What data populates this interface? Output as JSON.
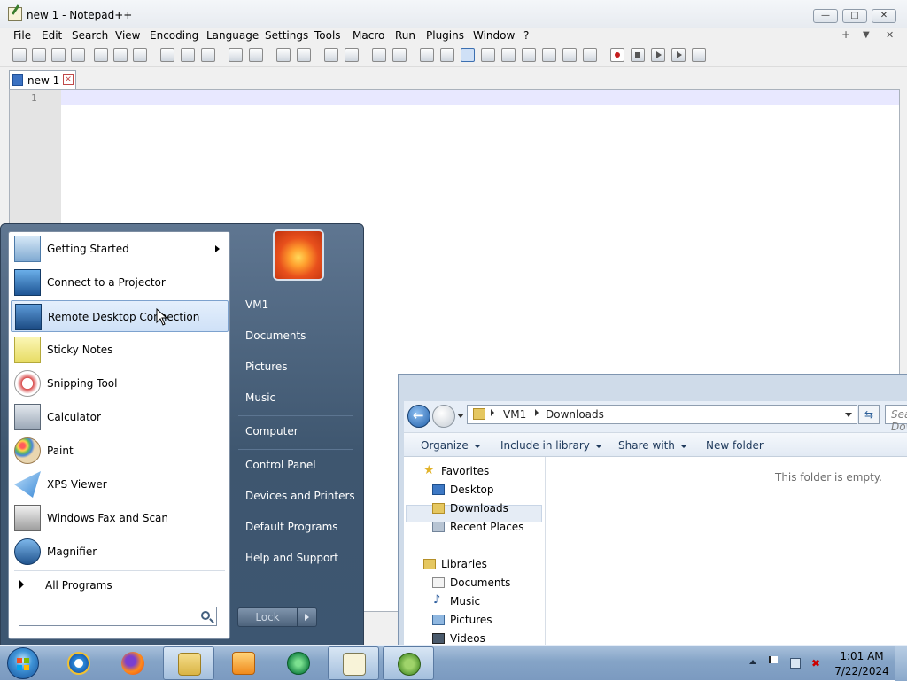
{
  "notepad": {
    "title": "new 1 - Notepad++",
    "menu": [
      "File",
      "Edit",
      "Search",
      "View",
      "Encoding",
      "Language",
      "Settings",
      "Tools",
      "Macro",
      "Run",
      "Plugins",
      "Window",
      "?"
    ],
    "menu_right": [
      "+",
      "▼",
      "✕"
    ],
    "tab_label": "new 1",
    "line_number": "1",
    "window_buttons": {
      "minimize": "—",
      "maximize": "□",
      "close": "✕"
    }
  },
  "explorer": {
    "breadcrumb": [
      "VM1",
      "Downloads"
    ],
    "search_placeholder": "Search Downloads",
    "commands": [
      "Organize",
      "Include in library",
      "Share with",
      "New folder"
    ],
    "nav": {
      "favorites_header": "Favorites",
      "favorites": [
        "Desktop",
        "Downloads",
        "Recent Places"
      ],
      "libraries_header": "Libraries",
      "libraries": [
        "Documents",
        "Music",
        "Pictures",
        "Videos"
      ],
      "selected": "Downloads"
    },
    "empty_message": "This folder is empty."
  },
  "start_menu": {
    "programs": [
      {
        "label": "Getting Started",
        "icon": "getting-started-icon",
        "has_submenu": true
      },
      {
        "label": "Connect to a Projector",
        "icon": "projector-icon"
      },
      {
        "label": "Remote Desktop Connection",
        "icon": "remote-desktop-icon",
        "highlighted": true
      },
      {
        "label": "Sticky Notes",
        "icon": "sticky-notes-icon"
      },
      {
        "label": "Snipping Tool",
        "icon": "scissors-icon"
      },
      {
        "label": "Calculator",
        "icon": "calculator-icon"
      },
      {
        "label": "Paint",
        "icon": "paint-palette-icon"
      },
      {
        "label": "XPS Viewer",
        "icon": "xps-viewer-icon"
      },
      {
        "label": "Windows Fax and Scan",
        "icon": "fax-icon"
      },
      {
        "label": "Magnifier",
        "icon": "magnifier-icon"
      }
    ],
    "all_programs": "All Programs",
    "search_placeholder": "",
    "right_items": [
      "VM1",
      "Documents",
      "Pictures",
      "Music",
      "Computer",
      "Control Panel",
      "Devices and Printers",
      "Default Programs",
      "Help and Support"
    ],
    "lock_label": "Lock"
  },
  "taskbar": {
    "apps": [
      "internet-explorer-icon",
      "firefox-icon",
      "file-explorer-icon",
      "media-player-icon",
      "media-center-icon",
      "notepadpp-icon",
      "notepadpp-chameleon-icon"
    ],
    "clock_time": "1:01 AM",
    "clock_date": "7/22/2024"
  },
  "colors": {
    "start_menu_bg": "#4a627c",
    "selection_highlight": "#cfe1f7",
    "taskbar": "#85a4c7",
    "caret_line": "#e8e8ff"
  }
}
